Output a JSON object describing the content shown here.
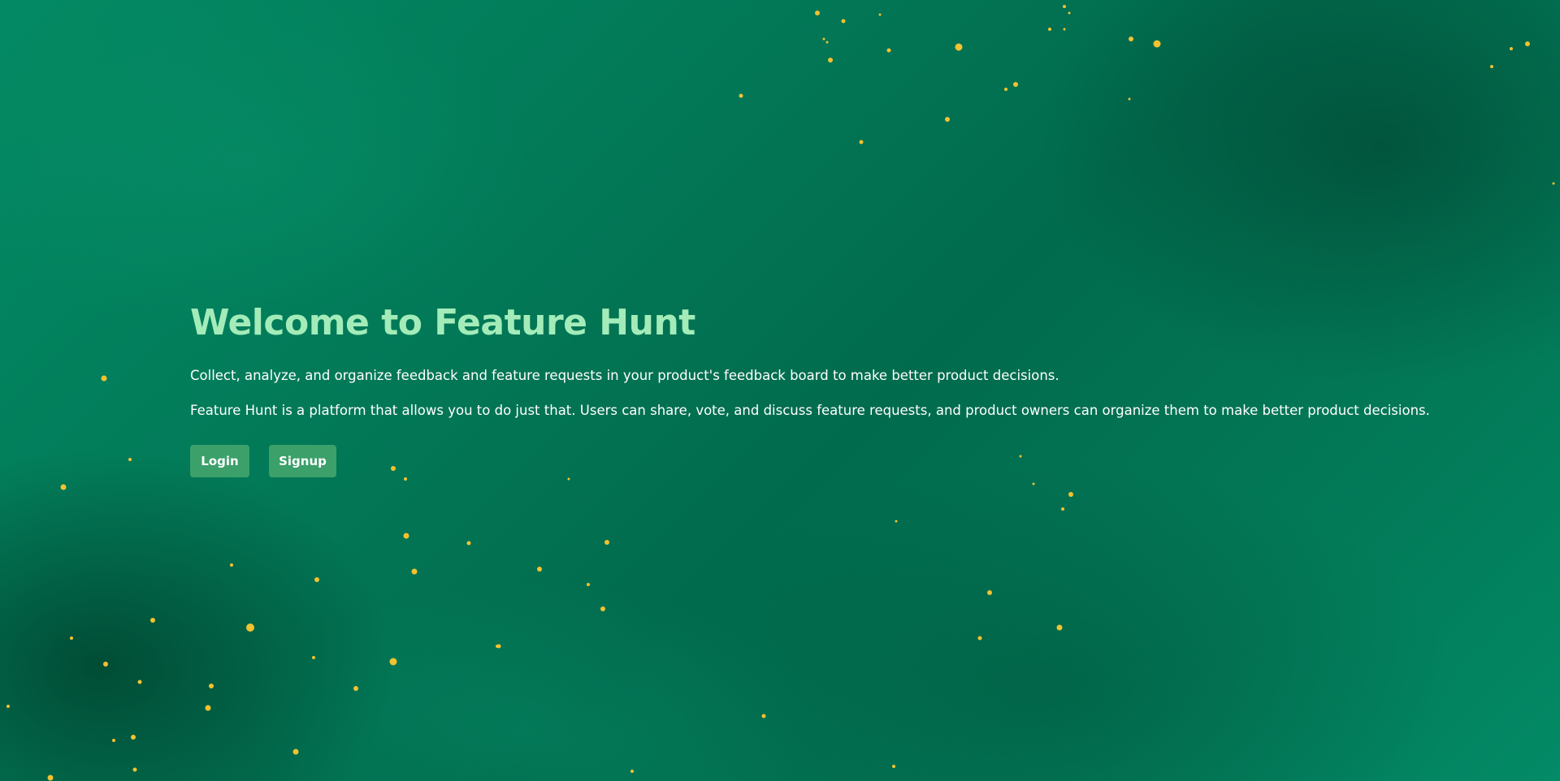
{
  "hero": {
    "title": "Welcome to Feature Hunt",
    "paragraph_1": "Collect, analyze, and organize feedback and feature requests in your product's feedback board to make better product decisions.",
    "paragraph_2": "Feature Hunt is a platform that allows you to do just that. Users can share, vote, and discuss feature requests, and product owners can organize them to make better product decisions."
  },
  "actions": {
    "login_label": "Login",
    "signup_label": "Signup"
  },
  "colors": {
    "title": "#a3ecb9",
    "button_background": "#3ba06a",
    "background_primary": "#027a58",
    "speckle": "#f2c230"
  }
}
